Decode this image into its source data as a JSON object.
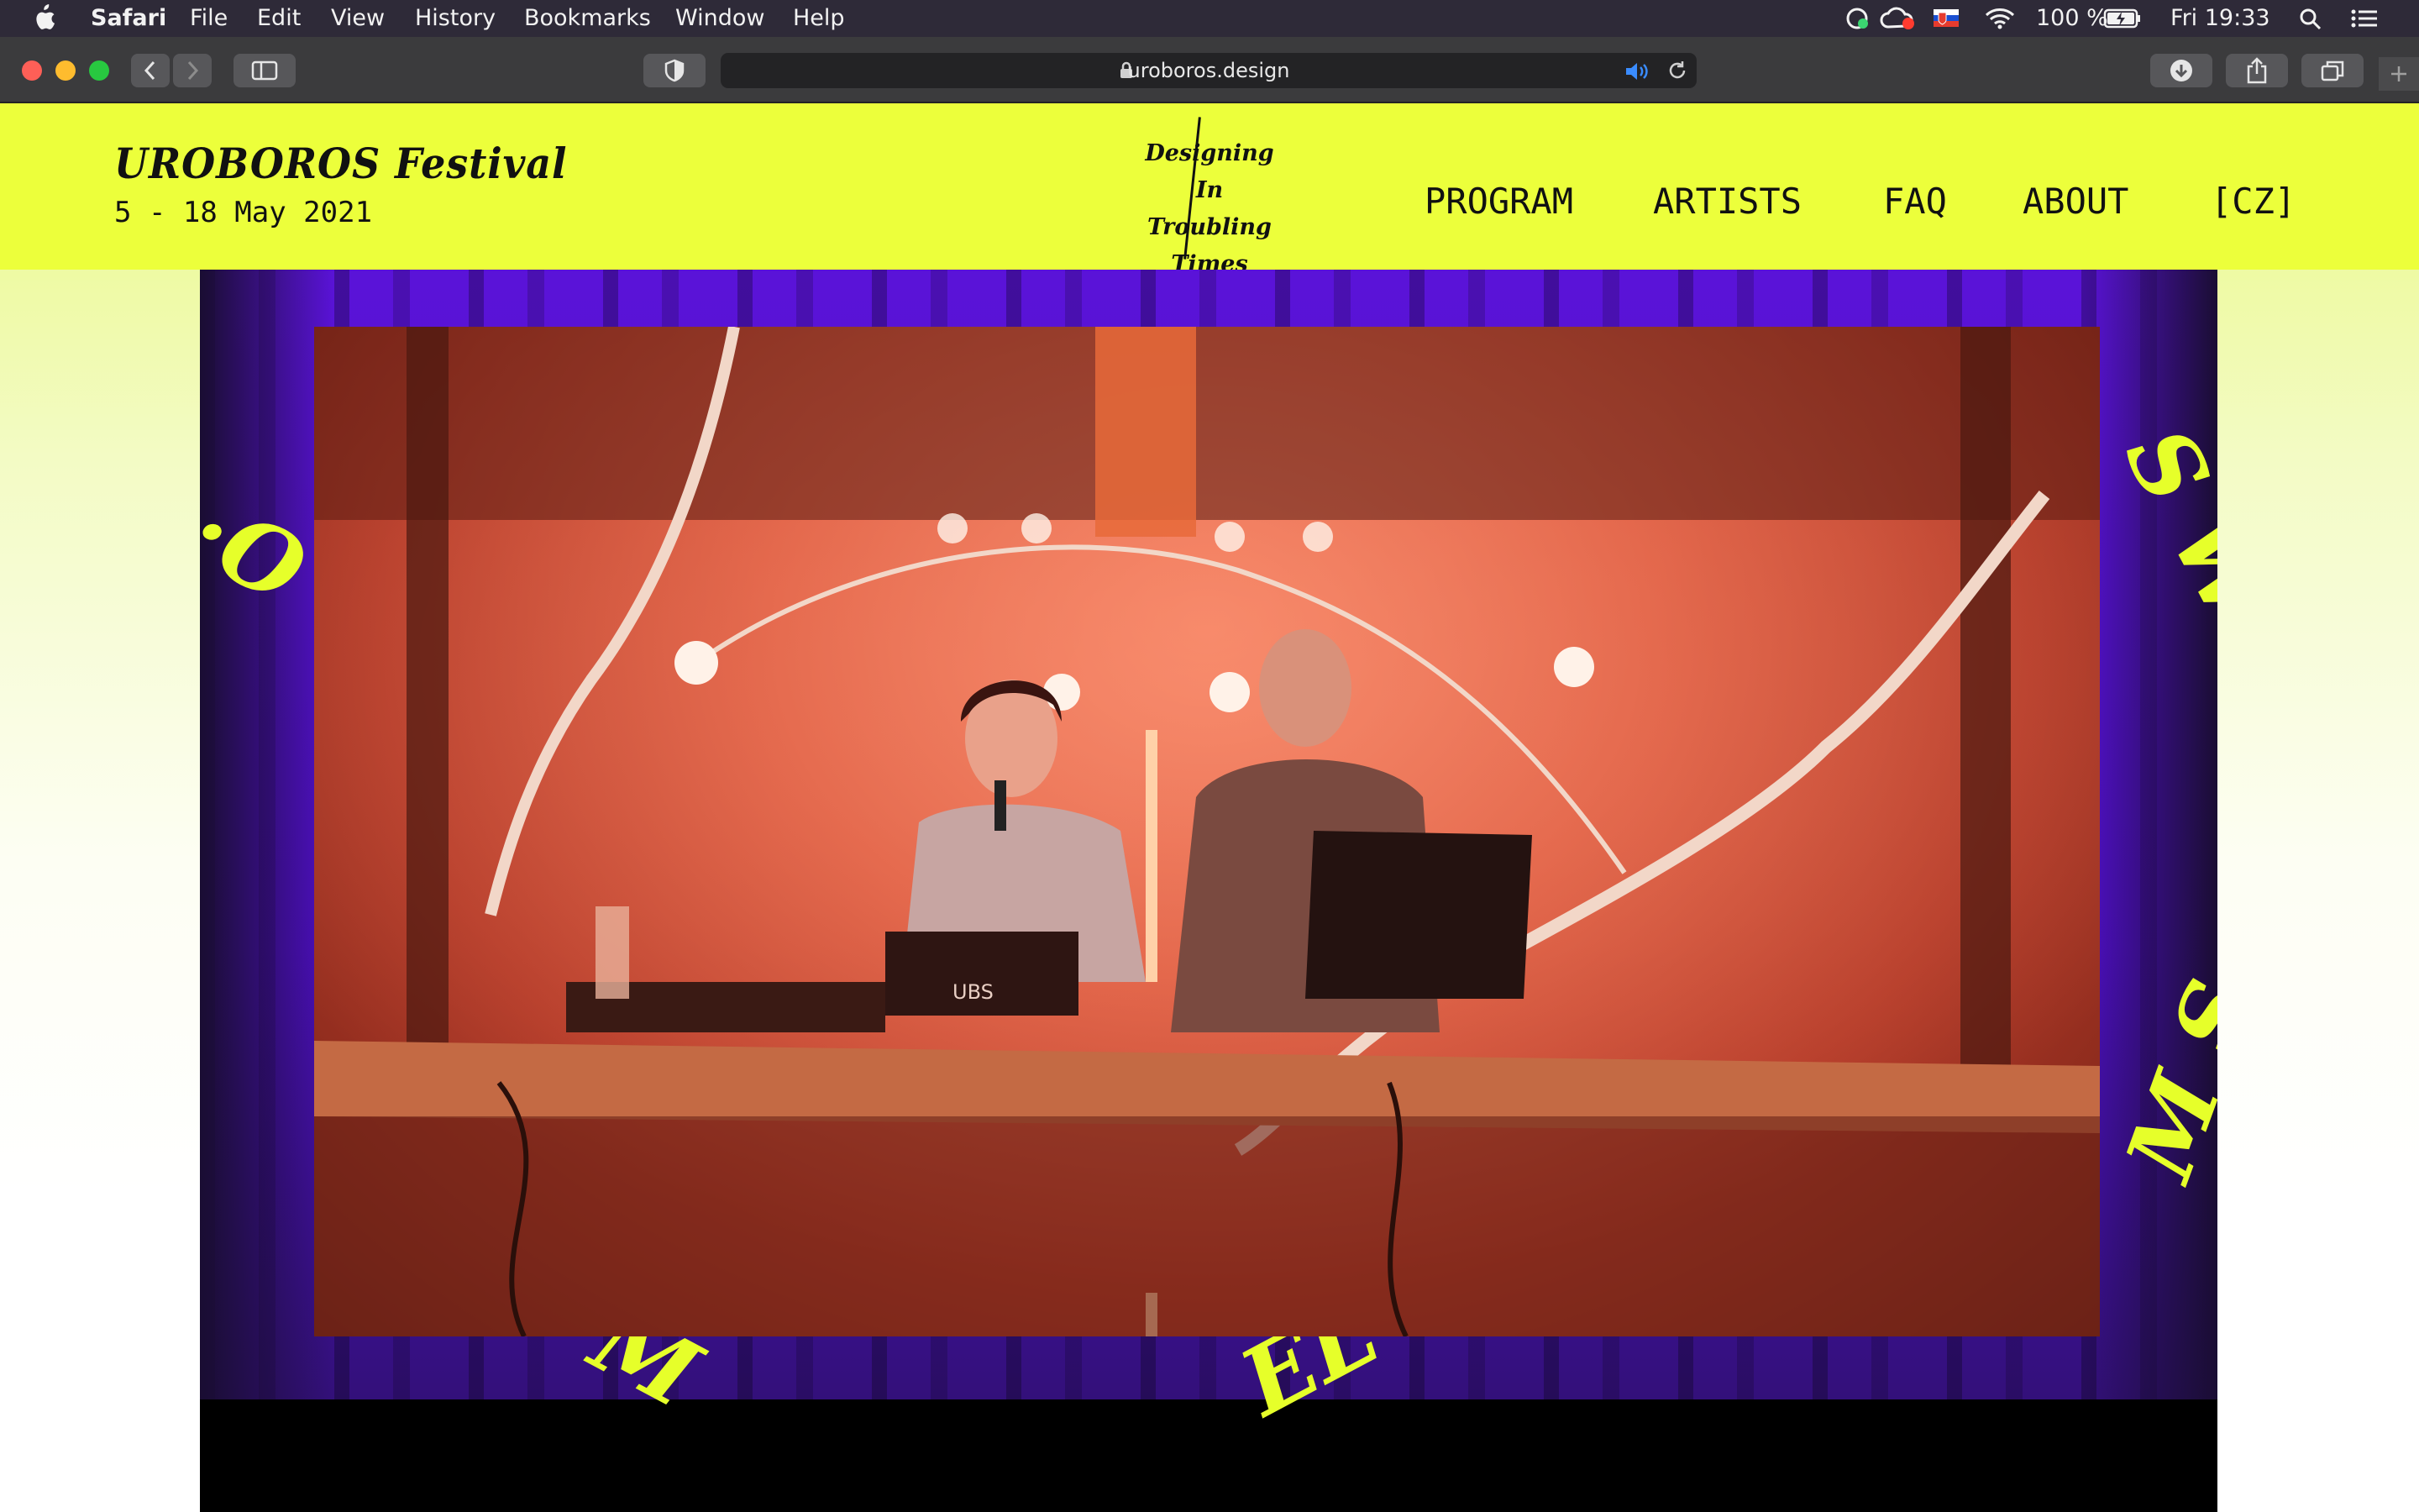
{
  "menubar": {
    "app_name": "Safari",
    "menus": [
      "File",
      "Edit",
      "View",
      "History",
      "Bookmarks",
      "Window",
      "Help"
    ],
    "battery": "100 %",
    "clock": "Fri 19:33"
  },
  "browser": {
    "url": "uroboros.design"
  },
  "site": {
    "title": "UROBOROS Festival",
    "dates": "5 - 18 May 2021",
    "tagline": [
      "Designing",
      "In Troubling",
      "Times"
    ],
    "nav": [
      "PROGRAM",
      "ARTISTS",
      "FAQ",
      "ABOUT",
      "[CZ]"
    ]
  },
  "video": {
    "device_label": "UBS"
  },
  "colors": {
    "header_bg": "#ecff3b",
    "stage_purple": "#5a13d8",
    "accent_yellow": "#e6ff2a"
  }
}
